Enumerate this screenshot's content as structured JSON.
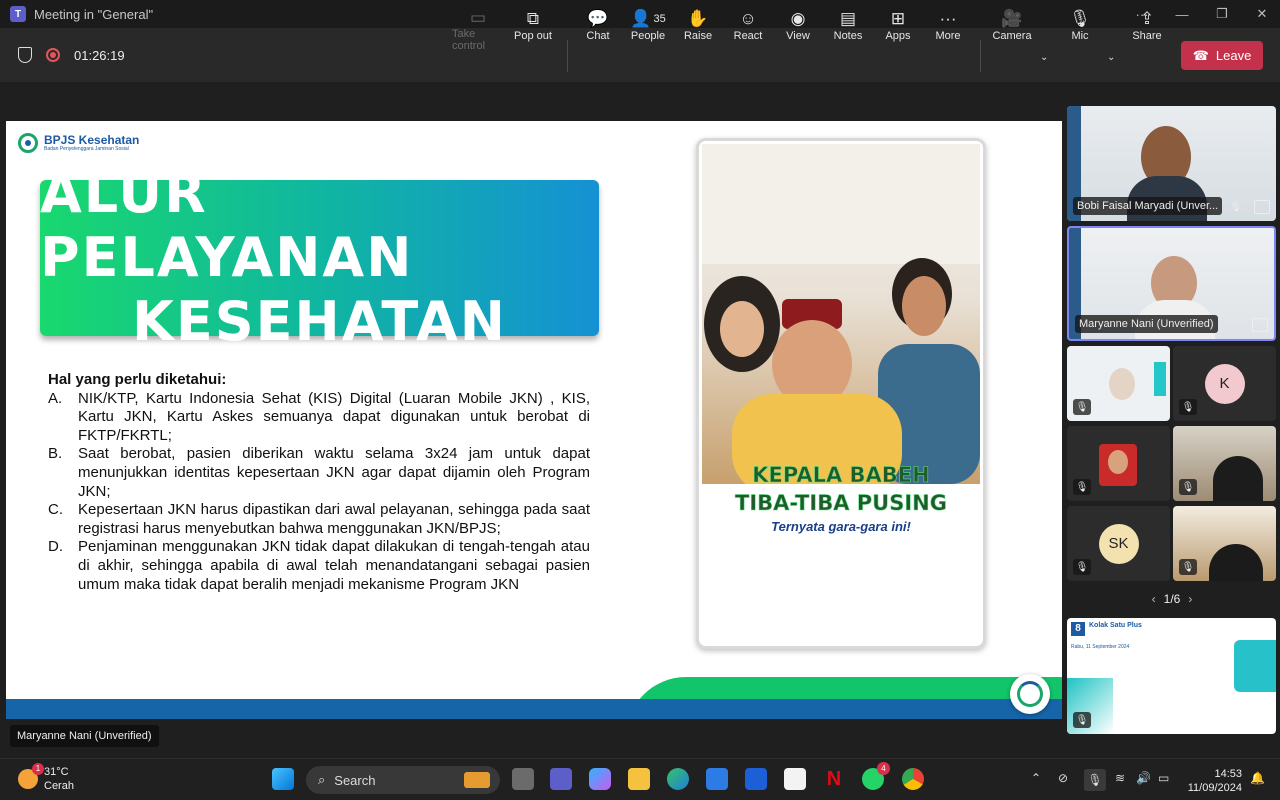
{
  "window": {
    "title": "Meeting in \"General\""
  },
  "toolbar": {
    "timer": "01:26:19",
    "buttons": [
      {
        "label": "Take control",
        "icon": "take-control-icon"
      },
      {
        "label": "Pop out",
        "icon": "pop-out-icon"
      },
      {
        "label": "Chat",
        "icon": "chat-icon"
      },
      {
        "label": "People",
        "icon": "people-icon",
        "count": "35"
      },
      {
        "label": "Raise",
        "icon": "raise-hand-icon"
      },
      {
        "label": "React",
        "icon": "react-icon"
      },
      {
        "label": "View",
        "icon": "view-icon"
      },
      {
        "label": "Notes",
        "icon": "notes-icon"
      },
      {
        "label": "Apps",
        "icon": "apps-icon"
      },
      {
        "label": "More",
        "icon": "more-icon"
      },
      {
        "label": "Camera",
        "icon": "camera-icon"
      },
      {
        "label": "Mic",
        "icon": "mic-off-icon"
      },
      {
        "label": "Share",
        "icon": "share-icon"
      }
    ],
    "leave_label": "Leave",
    "leave_color": "#c4314b"
  },
  "slide": {
    "brand": "BPJS Kesehatan",
    "brand_sub": "Badan Penyelenggara Jaminan Sosial",
    "title_line1": "ALUR PELAYANAN",
    "title_line2": "KESEHATAN",
    "intro": "Hal yang perlu diketahui:",
    "points": [
      {
        "key": "A.",
        "text": "NIK/KTP,  Kartu Indonesia Sehat (KIS) Digital (Luaran Mobile JKN) , KIS, Kartu JKN, Kartu Askes semuanya dapat digunakan untuk berobat di FKTP/FKRTL;"
      },
      {
        "key": "B.",
        "text": "Saat berobat, pasien diberikan waktu selama 3x24 jam untuk dapat menunjukkan identitas kepesertaan JKN agar dapat dijamin oleh Program JKN;"
      },
      {
        "key": "C.",
        "text": "Kepesertaan JKN harus dipastikan dari awal pelayanan, sehingga pada saat registrasi harus menyebutkan bahwa menggunakan JKN/BPJS;"
      },
      {
        "key": "D.",
        "text": "Penjaminan menggunakan JKN tidak dapat dilakukan di tengah-tengah atau di akhir, sehingga apabila di awal telah menandatangani sebagai pasien umum maka tidak dapat beralih menjadi mekanisme Program JKN"
      }
    ],
    "phone_caption1": "KEPALA BABEH",
    "phone_caption2": "TIBA-TIBA PUSING",
    "phone_caption3": "Ternyata gara-gara ini!"
  },
  "speaker_tag": "Maryanne Nani (Unverified)",
  "participants": [
    {
      "name": "Bobi Faisal Maryadi (Unver...",
      "type": "video"
    },
    {
      "name": "Maryanne Nani (Unverified)",
      "type": "video"
    },
    {
      "name": "",
      "type": "video"
    },
    {
      "initials": "K",
      "type": "avatar",
      "color": "#f2c9cf"
    },
    {
      "name": "",
      "type": "video"
    },
    {
      "name": "",
      "type": "video"
    },
    {
      "initials": "SK",
      "type": "avatar",
      "color": "#f3e2b0"
    },
    {
      "name": "",
      "type": "video"
    }
  ],
  "pager": "1/6",
  "mini_slide": {
    "number": "8",
    "title": "Kolak Satu Plus",
    "date": "Rabu, 11 September 2024"
  },
  "taskbar": {
    "weather_temp": "31°C",
    "weather_desc": "Cerah",
    "weather_badge": "1",
    "search_label": "Search",
    "whatsapp_badge": "4",
    "time": "14:53",
    "date": "11/09/2024"
  }
}
